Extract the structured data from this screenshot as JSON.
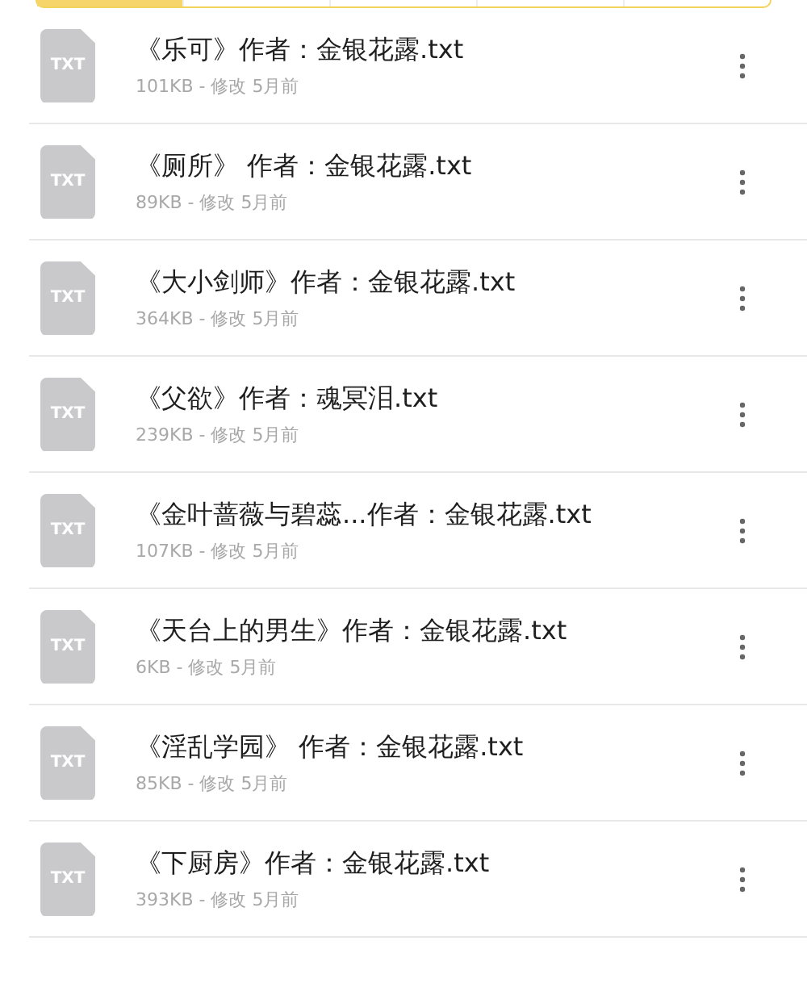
{
  "files": [
    {
      "name": "《乐可》作者：金银花露.txt",
      "meta": "101KB - 修改 5月前",
      "icon_label": "TXT"
    },
    {
      "name": "《厕所》 作者：金银花露.txt",
      "meta": "89KB - 修改 5月前",
      "icon_label": "TXT"
    },
    {
      "name": "《大小剑师》作者：金银花露.txt",
      "meta": "364KB - 修改 5月前",
      "icon_label": "TXT"
    },
    {
      "name": "《父欲》作者：魂冥泪.txt",
      "meta": "239KB - 修改 5月前",
      "icon_label": "TXT"
    },
    {
      "name": "《金叶蔷薇与碧蕊...作者：金银花露.txt",
      "meta": "107KB - 修改 5月前",
      "icon_label": "TXT"
    },
    {
      "name": "《天台上的男生》作者：金银花露.txt",
      "meta": "6KB - 修改 5月前",
      "icon_label": "TXT"
    },
    {
      "name": "《淫乱学园》 作者：金银花露.txt",
      "meta": "85KB - 修改 5月前",
      "icon_label": "TXT"
    },
    {
      "name": "《下厨房》作者：金银花露.txt",
      "meta": "393KB - 修改 5月前",
      "icon_label": "TXT"
    }
  ]
}
